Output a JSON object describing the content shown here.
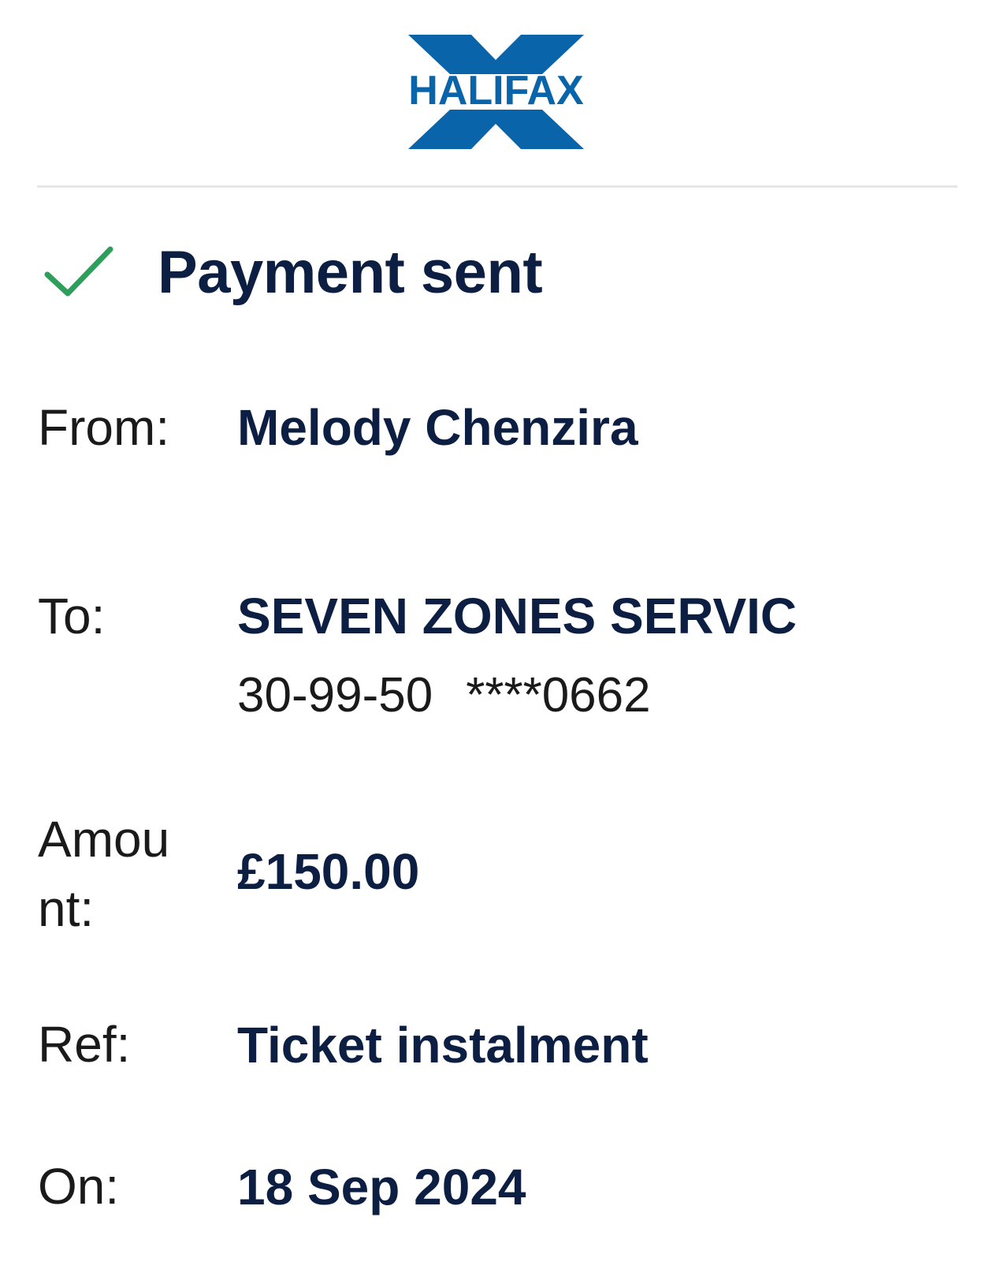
{
  "brand": {
    "name": "HALIFAX",
    "color": "#0a64aa"
  },
  "status": {
    "title": "Payment sent",
    "icon": "check-icon",
    "icon_color": "#2e9e5b"
  },
  "details": {
    "from": {
      "label": "From:",
      "value": "Melody Chenzira"
    },
    "to": {
      "label": "To:",
      "value": "SEVEN ZONES SERVIC",
      "sort_code": "30-99-50",
      "account": "****0662"
    },
    "amount": {
      "label_line1": "Amou",
      "label_line2": "nt:",
      "value": "£150.00"
    },
    "ref": {
      "label": "Ref:",
      "value": "Ticket instalment"
    },
    "on": {
      "label": "On:",
      "value": "18 Sep 2024"
    }
  }
}
